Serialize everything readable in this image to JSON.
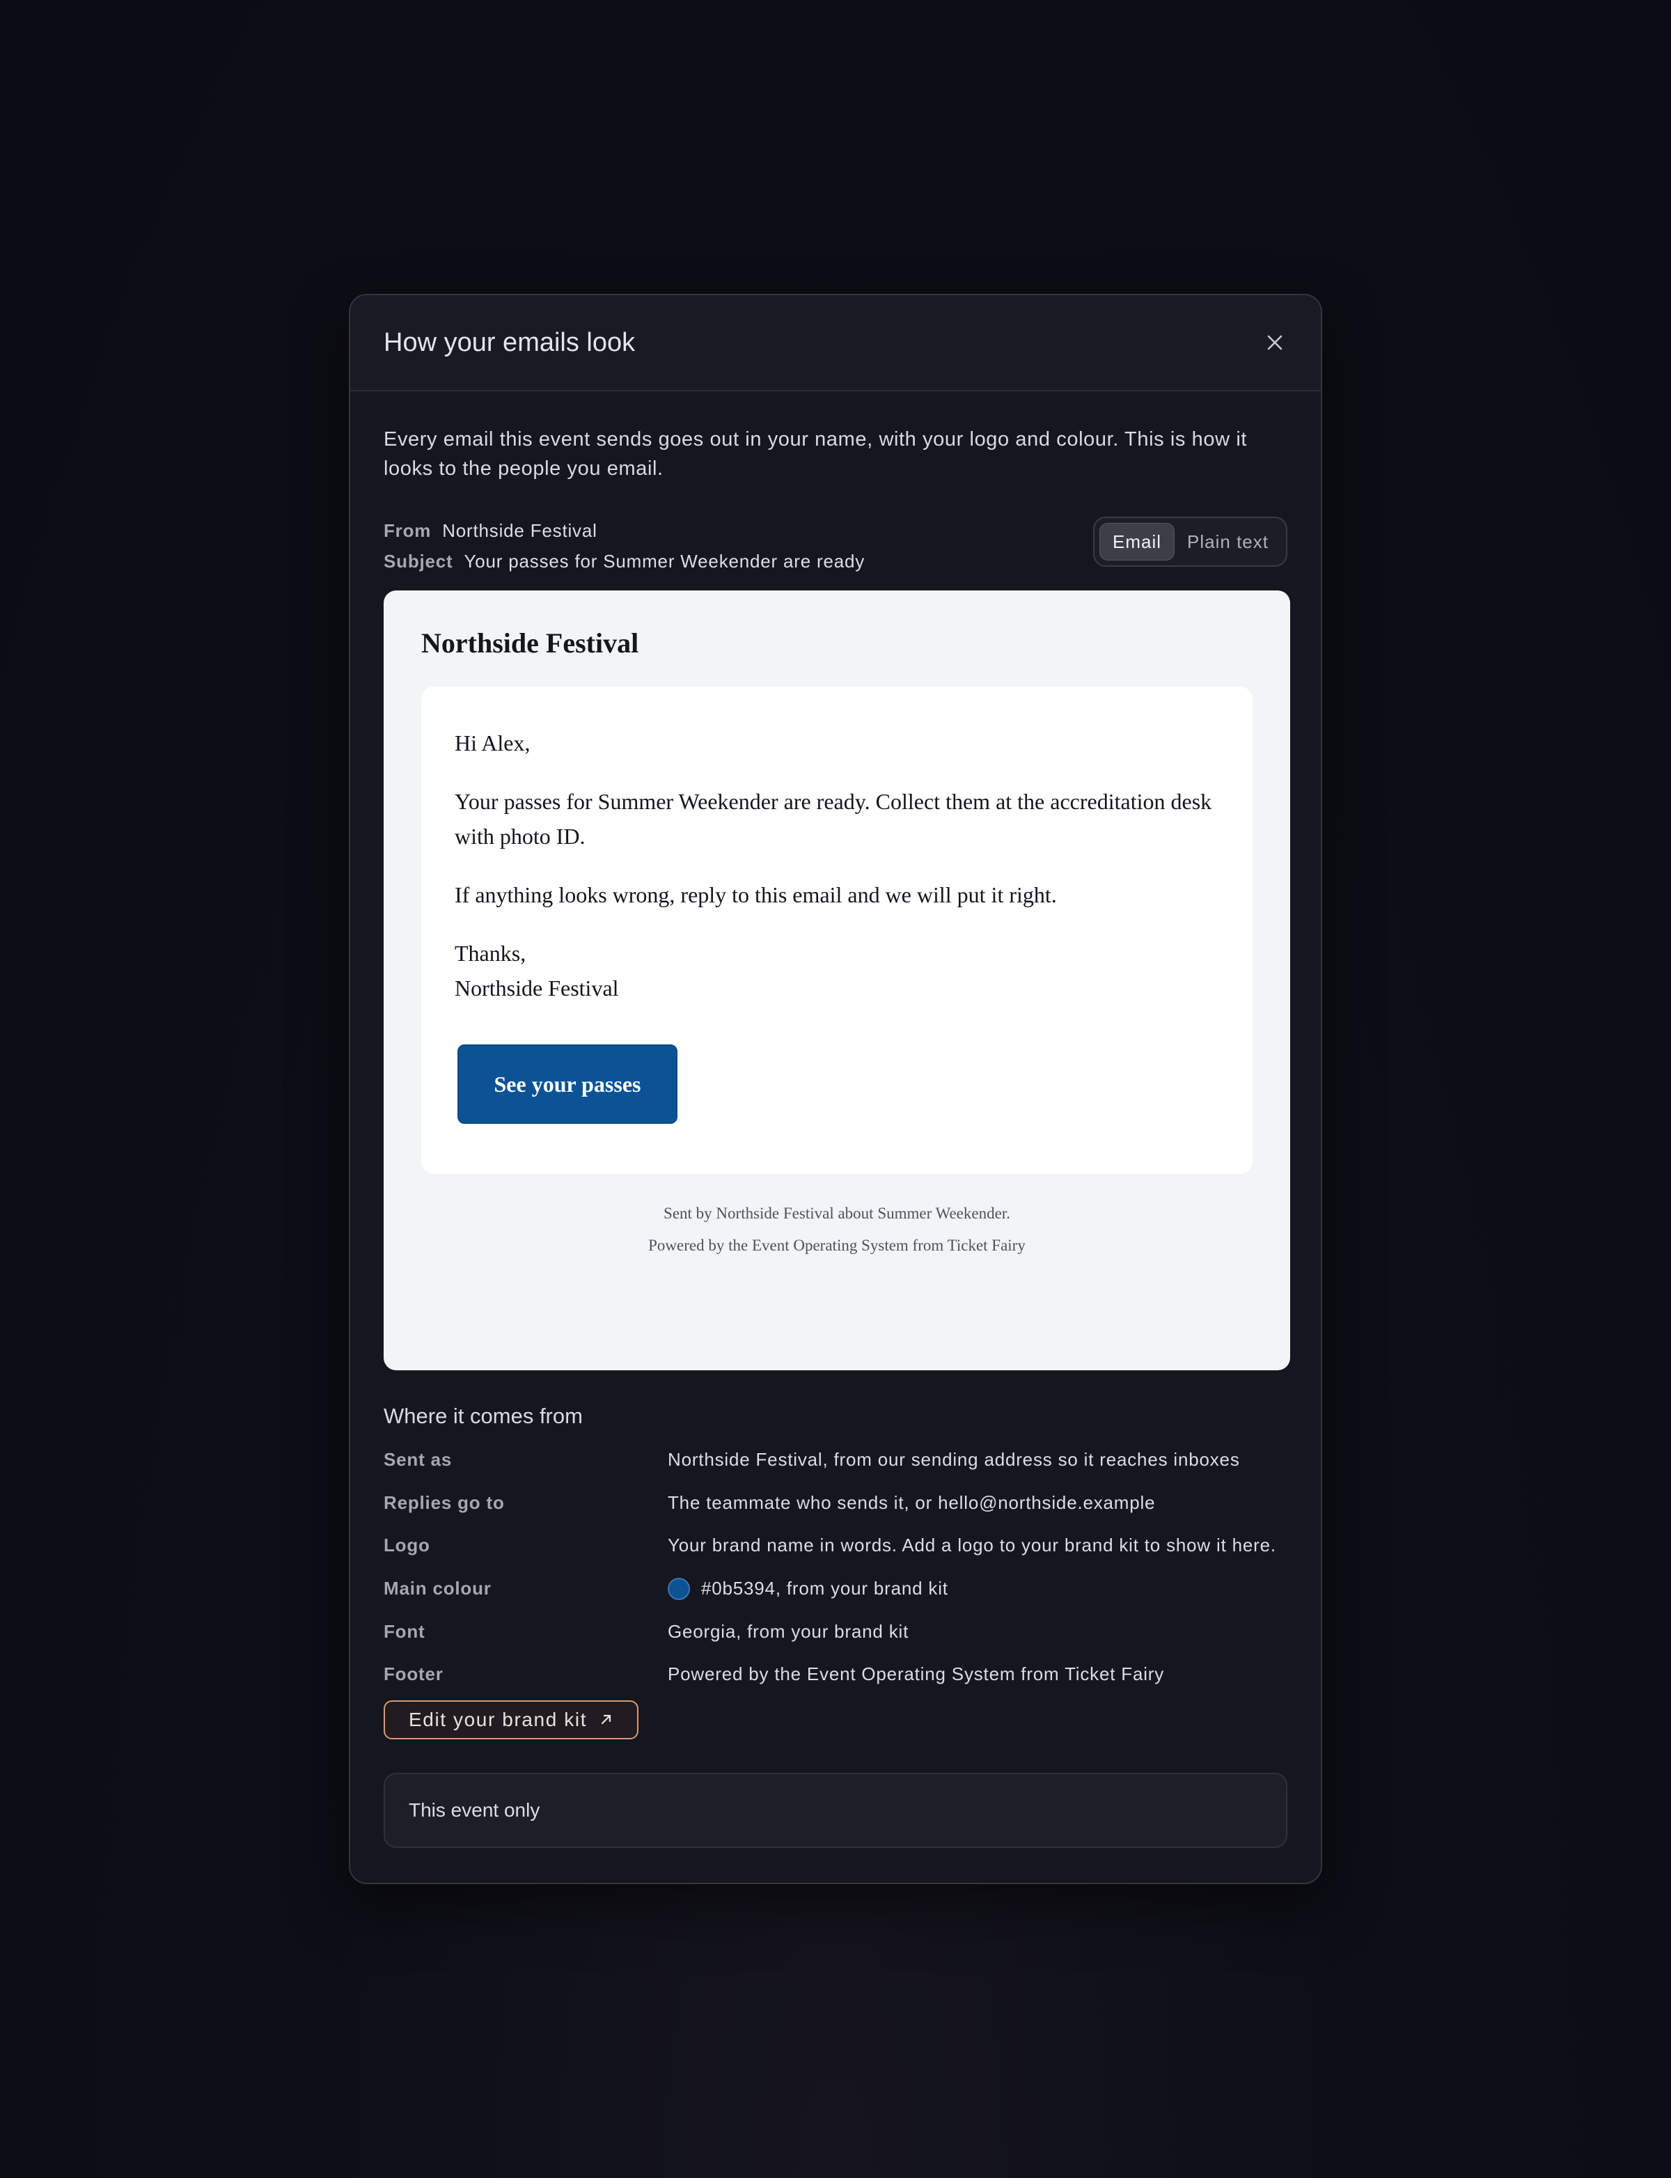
{
  "modal": {
    "title": "How your emails look",
    "close_icon": "close-icon",
    "intro": "Every email this event sends goes out in your name, with your logo and colour. This is how it looks to the people you email."
  },
  "meta": {
    "from_label": "From",
    "from_value": "Northside Festival",
    "subject_label": "Subject",
    "subject_value": "Your passes for Summer Weekender are ready"
  },
  "view_toggle": {
    "options": [
      "Email",
      "Plain text"
    ],
    "selected": "Email"
  },
  "preview": {
    "brand_name": "Northside Festival",
    "greeting": "Hi Alex,",
    "body_1": "Your passes for Summer Weekender are ready. Collect them at the accreditation desk with photo ID.",
    "body_2": "If anything looks wrong, reply to this email and we will put it right.",
    "signoff": "Thanks,",
    "signature": "Northside Festival",
    "cta_label": "See your passes",
    "footer_line_1": "Sent by Northside Festival about Summer Weekender.",
    "footer_line_2": "Powered by the Event Operating System from Ticket Fairy"
  },
  "where": {
    "title": "Where it comes from",
    "rows": [
      {
        "label": "Sent as",
        "value": "Northside Festival, from our sending address so it reaches inboxes"
      },
      {
        "label": "Replies go to",
        "value": "The teammate who sends it, or hello@northside.example"
      },
      {
        "label": "Logo",
        "value": "Your brand name in words. Add a logo to your brand kit to show it here."
      },
      {
        "label": "Main colour",
        "value": "#0b5394, from your brand kit"
      },
      {
        "label": "Font",
        "value": "Georgia, from your brand kit"
      },
      {
        "label": "Footer",
        "value": "Powered by the Event Operating System from Ticket Fairy"
      }
    ],
    "edit_button_label": "Edit your brand kit",
    "edit_button_icon": "external-link-icon",
    "scope_label": "This event only"
  },
  "colors": {
    "brand": "#0b5394",
    "accent_border": "#d99a78"
  }
}
